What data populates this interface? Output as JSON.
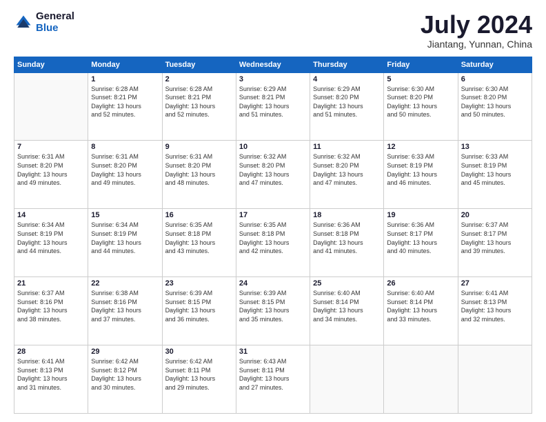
{
  "logo": {
    "general": "General",
    "blue": "Blue"
  },
  "header": {
    "month": "July 2024",
    "location": "Jiantang, Yunnan, China"
  },
  "weekdays": [
    "Sunday",
    "Monday",
    "Tuesday",
    "Wednesday",
    "Thursday",
    "Friday",
    "Saturday"
  ],
  "weeks": [
    [
      {
        "day": "",
        "info": ""
      },
      {
        "day": "1",
        "info": "Sunrise: 6:28 AM\nSunset: 8:21 PM\nDaylight: 13 hours\nand 52 minutes."
      },
      {
        "day": "2",
        "info": "Sunrise: 6:28 AM\nSunset: 8:21 PM\nDaylight: 13 hours\nand 52 minutes."
      },
      {
        "day": "3",
        "info": "Sunrise: 6:29 AM\nSunset: 8:21 PM\nDaylight: 13 hours\nand 51 minutes."
      },
      {
        "day": "4",
        "info": "Sunrise: 6:29 AM\nSunset: 8:20 PM\nDaylight: 13 hours\nand 51 minutes."
      },
      {
        "day": "5",
        "info": "Sunrise: 6:30 AM\nSunset: 8:20 PM\nDaylight: 13 hours\nand 50 minutes."
      },
      {
        "day": "6",
        "info": "Sunrise: 6:30 AM\nSunset: 8:20 PM\nDaylight: 13 hours\nand 50 minutes."
      }
    ],
    [
      {
        "day": "7",
        "info": "Sunrise: 6:31 AM\nSunset: 8:20 PM\nDaylight: 13 hours\nand 49 minutes."
      },
      {
        "day": "8",
        "info": "Sunrise: 6:31 AM\nSunset: 8:20 PM\nDaylight: 13 hours\nand 49 minutes."
      },
      {
        "day": "9",
        "info": "Sunrise: 6:31 AM\nSunset: 8:20 PM\nDaylight: 13 hours\nand 48 minutes."
      },
      {
        "day": "10",
        "info": "Sunrise: 6:32 AM\nSunset: 8:20 PM\nDaylight: 13 hours\nand 47 minutes."
      },
      {
        "day": "11",
        "info": "Sunrise: 6:32 AM\nSunset: 8:20 PM\nDaylight: 13 hours\nand 47 minutes."
      },
      {
        "day": "12",
        "info": "Sunrise: 6:33 AM\nSunset: 8:19 PM\nDaylight: 13 hours\nand 46 minutes."
      },
      {
        "day": "13",
        "info": "Sunrise: 6:33 AM\nSunset: 8:19 PM\nDaylight: 13 hours\nand 45 minutes."
      }
    ],
    [
      {
        "day": "14",
        "info": "Sunrise: 6:34 AM\nSunset: 8:19 PM\nDaylight: 13 hours\nand 44 minutes."
      },
      {
        "day": "15",
        "info": "Sunrise: 6:34 AM\nSunset: 8:19 PM\nDaylight: 13 hours\nand 44 minutes."
      },
      {
        "day": "16",
        "info": "Sunrise: 6:35 AM\nSunset: 8:18 PM\nDaylight: 13 hours\nand 43 minutes."
      },
      {
        "day": "17",
        "info": "Sunrise: 6:35 AM\nSunset: 8:18 PM\nDaylight: 13 hours\nand 42 minutes."
      },
      {
        "day": "18",
        "info": "Sunrise: 6:36 AM\nSunset: 8:18 PM\nDaylight: 13 hours\nand 41 minutes."
      },
      {
        "day": "19",
        "info": "Sunrise: 6:36 AM\nSunset: 8:17 PM\nDaylight: 13 hours\nand 40 minutes."
      },
      {
        "day": "20",
        "info": "Sunrise: 6:37 AM\nSunset: 8:17 PM\nDaylight: 13 hours\nand 39 minutes."
      }
    ],
    [
      {
        "day": "21",
        "info": "Sunrise: 6:37 AM\nSunset: 8:16 PM\nDaylight: 13 hours\nand 38 minutes."
      },
      {
        "day": "22",
        "info": "Sunrise: 6:38 AM\nSunset: 8:16 PM\nDaylight: 13 hours\nand 37 minutes."
      },
      {
        "day": "23",
        "info": "Sunrise: 6:39 AM\nSunset: 8:15 PM\nDaylight: 13 hours\nand 36 minutes."
      },
      {
        "day": "24",
        "info": "Sunrise: 6:39 AM\nSunset: 8:15 PM\nDaylight: 13 hours\nand 35 minutes."
      },
      {
        "day": "25",
        "info": "Sunrise: 6:40 AM\nSunset: 8:14 PM\nDaylight: 13 hours\nand 34 minutes."
      },
      {
        "day": "26",
        "info": "Sunrise: 6:40 AM\nSunset: 8:14 PM\nDaylight: 13 hours\nand 33 minutes."
      },
      {
        "day": "27",
        "info": "Sunrise: 6:41 AM\nSunset: 8:13 PM\nDaylight: 13 hours\nand 32 minutes."
      }
    ],
    [
      {
        "day": "28",
        "info": "Sunrise: 6:41 AM\nSunset: 8:13 PM\nDaylight: 13 hours\nand 31 minutes."
      },
      {
        "day": "29",
        "info": "Sunrise: 6:42 AM\nSunset: 8:12 PM\nDaylight: 13 hours\nand 30 minutes."
      },
      {
        "day": "30",
        "info": "Sunrise: 6:42 AM\nSunset: 8:11 PM\nDaylight: 13 hours\nand 29 minutes."
      },
      {
        "day": "31",
        "info": "Sunrise: 6:43 AM\nSunset: 8:11 PM\nDaylight: 13 hours\nand 27 minutes."
      },
      {
        "day": "",
        "info": ""
      },
      {
        "day": "",
        "info": ""
      },
      {
        "day": "",
        "info": ""
      }
    ]
  ]
}
